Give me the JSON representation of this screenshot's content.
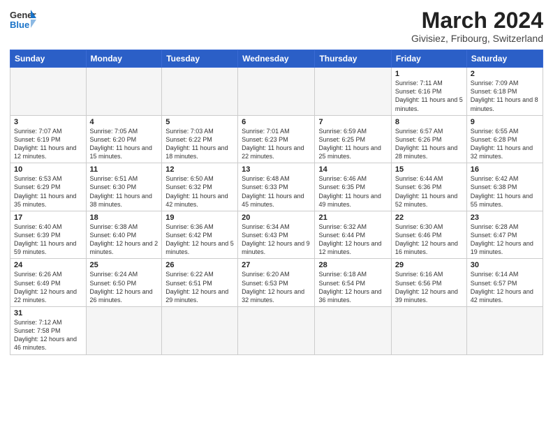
{
  "header": {
    "logo_general": "General",
    "logo_blue": "Blue",
    "month_year": "March 2024",
    "location": "Givisiez, Fribourg, Switzerland"
  },
  "weekdays": [
    "Sunday",
    "Monday",
    "Tuesday",
    "Wednesday",
    "Thursday",
    "Friday",
    "Saturday"
  ],
  "weeks": [
    [
      {
        "day": "",
        "info": ""
      },
      {
        "day": "",
        "info": ""
      },
      {
        "day": "",
        "info": ""
      },
      {
        "day": "",
        "info": ""
      },
      {
        "day": "",
        "info": ""
      },
      {
        "day": "1",
        "info": "Sunrise: 7:11 AM\nSunset: 6:16 PM\nDaylight: 11 hours\nand 5 minutes."
      },
      {
        "day": "2",
        "info": "Sunrise: 7:09 AM\nSunset: 6:18 PM\nDaylight: 11 hours\nand 8 minutes."
      }
    ],
    [
      {
        "day": "3",
        "info": "Sunrise: 7:07 AM\nSunset: 6:19 PM\nDaylight: 11 hours\nand 12 minutes."
      },
      {
        "day": "4",
        "info": "Sunrise: 7:05 AM\nSunset: 6:20 PM\nDaylight: 11 hours\nand 15 minutes."
      },
      {
        "day": "5",
        "info": "Sunrise: 7:03 AM\nSunset: 6:22 PM\nDaylight: 11 hours\nand 18 minutes."
      },
      {
        "day": "6",
        "info": "Sunrise: 7:01 AM\nSunset: 6:23 PM\nDaylight: 11 hours\nand 22 minutes."
      },
      {
        "day": "7",
        "info": "Sunrise: 6:59 AM\nSunset: 6:25 PM\nDaylight: 11 hours\nand 25 minutes."
      },
      {
        "day": "8",
        "info": "Sunrise: 6:57 AM\nSunset: 6:26 PM\nDaylight: 11 hours\nand 28 minutes."
      },
      {
        "day": "9",
        "info": "Sunrise: 6:55 AM\nSunset: 6:28 PM\nDaylight: 11 hours\nand 32 minutes."
      }
    ],
    [
      {
        "day": "10",
        "info": "Sunrise: 6:53 AM\nSunset: 6:29 PM\nDaylight: 11 hours\nand 35 minutes."
      },
      {
        "day": "11",
        "info": "Sunrise: 6:51 AM\nSunset: 6:30 PM\nDaylight: 11 hours\nand 38 minutes."
      },
      {
        "day": "12",
        "info": "Sunrise: 6:50 AM\nSunset: 6:32 PM\nDaylight: 11 hours\nand 42 minutes."
      },
      {
        "day": "13",
        "info": "Sunrise: 6:48 AM\nSunset: 6:33 PM\nDaylight: 11 hours\nand 45 minutes."
      },
      {
        "day": "14",
        "info": "Sunrise: 6:46 AM\nSunset: 6:35 PM\nDaylight: 11 hours\nand 49 minutes."
      },
      {
        "day": "15",
        "info": "Sunrise: 6:44 AM\nSunset: 6:36 PM\nDaylight: 11 hours\nand 52 minutes."
      },
      {
        "day": "16",
        "info": "Sunrise: 6:42 AM\nSunset: 6:38 PM\nDaylight: 11 hours\nand 55 minutes."
      }
    ],
    [
      {
        "day": "17",
        "info": "Sunrise: 6:40 AM\nSunset: 6:39 PM\nDaylight: 11 hours\nand 59 minutes."
      },
      {
        "day": "18",
        "info": "Sunrise: 6:38 AM\nSunset: 6:40 PM\nDaylight: 12 hours\nand 2 minutes."
      },
      {
        "day": "19",
        "info": "Sunrise: 6:36 AM\nSunset: 6:42 PM\nDaylight: 12 hours\nand 5 minutes."
      },
      {
        "day": "20",
        "info": "Sunrise: 6:34 AM\nSunset: 6:43 PM\nDaylight: 12 hours\nand 9 minutes."
      },
      {
        "day": "21",
        "info": "Sunrise: 6:32 AM\nSunset: 6:44 PM\nDaylight: 12 hours\nand 12 minutes."
      },
      {
        "day": "22",
        "info": "Sunrise: 6:30 AM\nSunset: 6:46 PM\nDaylight: 12 hours\nand 16 minutes."
      },
      {
        "day": "23",
        "info": "Sunrise: 6:28 AM\nSunset: 6:47 PM\nDaylight: 12 hours\nand 19 minutes."
      }
    ],
    [
      {
        "day": "24",
        "info": "Sunrise: 6:26 AM\nSunset: 6:49 PM\nDaylight: 12 hours\nand 22 minutes."
      },
      {
        "day": "25",
        "info": "Sunrise: 6:24 AM\nSunset: 6:50 PM\nDaylight: 12 hours\nand 26 minutes."
      },
      {
        "day": "26",
        "info": "Sunrise: 6:22 AM\nSunset: 6:51 PM\nDaylight: 12 hours\nand 29 minutes."
      },
      {
        "day": "27",
        "info": "Sunrise: 6:20 AM\nSunset: 6:53 PM\nDaylight: 12 hours\nand 32 minutes."
      },
      {
        "day": "28",
        "info": "Sunrise: 6:18 AM\nSunset: 6:54 PM\nDaylight: 12 hours\nand 36 minutes."
      },
      {
        "day": "29",
        "info": "Sunrise: 6:16 AM\nSunset: 6:56 PM\nDaylight: 12 hours\nand 39 minutes."
      },
      {
        "day": "30",
        "info": "Sunrise: 6:14 AM\nSunset: 6:57 PM\nDaylight: 12 hours\nand 42 minutes."
      }
    ],
    [
      {
        "day": "31",
        "info": "Sunrise: 7:12 AM\nSunset: 7:58 PM\nDaylight: 12 hours\nand 46 minutes."
      },
      {
        "day": "",
        "info": ""
      },
      {
        "day": "",
        "info": ""
      },
      {
        "day": "",
        "info": ""
      },
      {
        "day": "",
        "info": ""
      },
      {
        "day": "",
        "info": ""
      },
      {
        "day": "",
        "info": ""
      }
    ]
  ]
}
